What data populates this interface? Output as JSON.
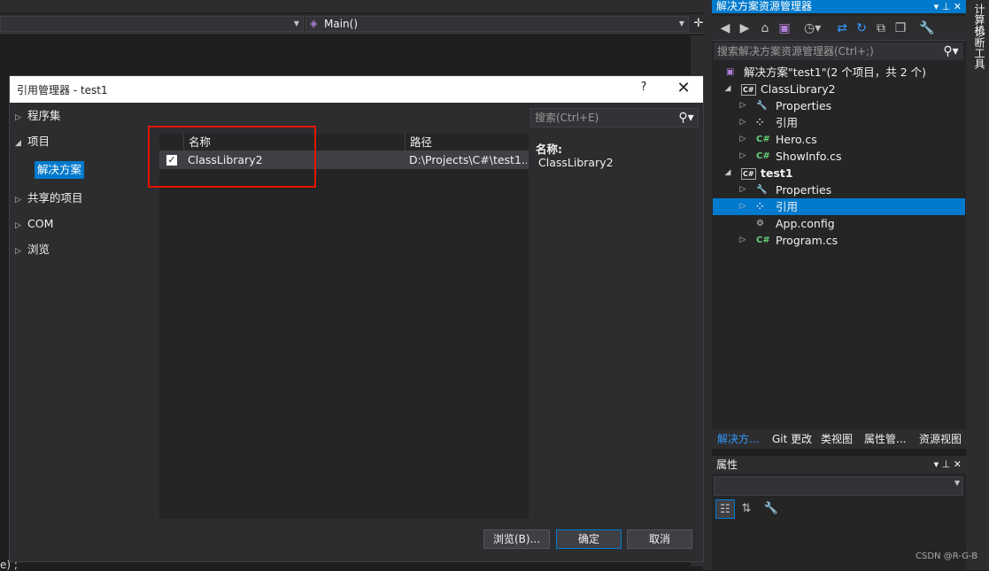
{
  "editor": {
    "nav_method": "Main()",
    "left_fragment": "e) ;"
  },
  "dialog": {
    "title": "引用管理器 - test1",
    "help": "?",
    "close": "✕",
    "nav": [
      {
        "label": "程序集",
        "expanded": false
      },
      {
        "label": "项目",
        "expanded": true
      },
      {
        "label": "共享的项目",
        "expanded": false
      },
      {
        "label": "COM",
        "expanded": false
      },
      {
        "label": "浏览",
        "expanded": false
      }
    ],
    "nav_selected": "解决方案",
    "columns": {
      "name": "名称",
      "path": "路径"
    },
    "rows": [
      {
        "checked": true,
        "name": "ClassLibrary2",
        "path": "D:\\Projects\\C#\\test1..."
      }
    ],
    "search_placeholder": "搜索(Ctrl+E)",
    "detail_label": "名称:",
    "detail_value": "ClassLibrary2",
    "buttons": {
      "browse": "浏览(B)...",
      "ok": "确定",
      "cancel": "取消"
    }
  },
  "solution_explorer": {
    "title": "解决方案资源管理器",
    "search_placeholder": "搜索解决方案资源管理器(Ctrl+;)",
    "tree": [
      {
        "label": "解决方案\"test1\"(2 个项目，共 2 个)",
        "icon": "solution-icon",
        "level": 0,
        "arrow": "",
        "bold": false
      },
      {
        "label": "ClassLibrary2",
        "icon": "csharp-project-icon",
        "level": 1,
        "arrow": "▲",
        "bold": false
      },
      {
        "label": "Properties",
        "icon": "wrench-icon",
        "level": 2,
        "arrow": "▷",
        "bold": false
      },
      {
        "label": "引用",
        "icon": "references-icon",
        "level": 2,
        "arrow": "▷",
        "bold": false
      },
      {
        "label": "Hero.cs",
        "icon": "csharp-file-icon",
        "level": 2,
        "arrow": "▷",
        "bold": false
      },
      {
        "label": "ShowInfo.cs",
        "icon": "csharp-file-icon",
        "level": 2,
        "arrow": "▷",
        "bold": false
      },
      {
        "label": "test1",
        "icon": "csharp-project-icon",
        "level": 1,
        "arrow": "▲",
        "bold": true
      },
      {
        "label": "Properties",
        "icon": "wrench-icon",
        "level": 2,
        "arrow": "▷",
        "bold": false
      },
      {
        "label": "引用",
        "icon": "references-icon",
        "level": 2,
        "arrow": "▷",
        "bold": false,
        "selected": true
      },
      {
        "label": "App.config",
        "icon": "config-file-icon",
        "level": 2,
        "arrow": "",
        "bold": false
      },
      {
        "label": "Program.cs",
        "icon": "csharp-file-icon",
        "level": 2,
        "arrow": "▷",
        "bold": false
      }
    ],
    "tabs": [
      "解决方...",
      "Git 更改",
      "类视图",
      "属性管...",
      "资源视图"
    ]
  },
  "properties": {
    "title": "属性"
  },
  "vertical_tabs": [
    "计算机",
    "诊断工具"
  ],
  "watermark": "CSDN @R-G-B",
  "colors": {
    "accent": "#007acc",
    "highlight_box": "#e51400",
    "csharp_green": "#65d173"
  }
}
